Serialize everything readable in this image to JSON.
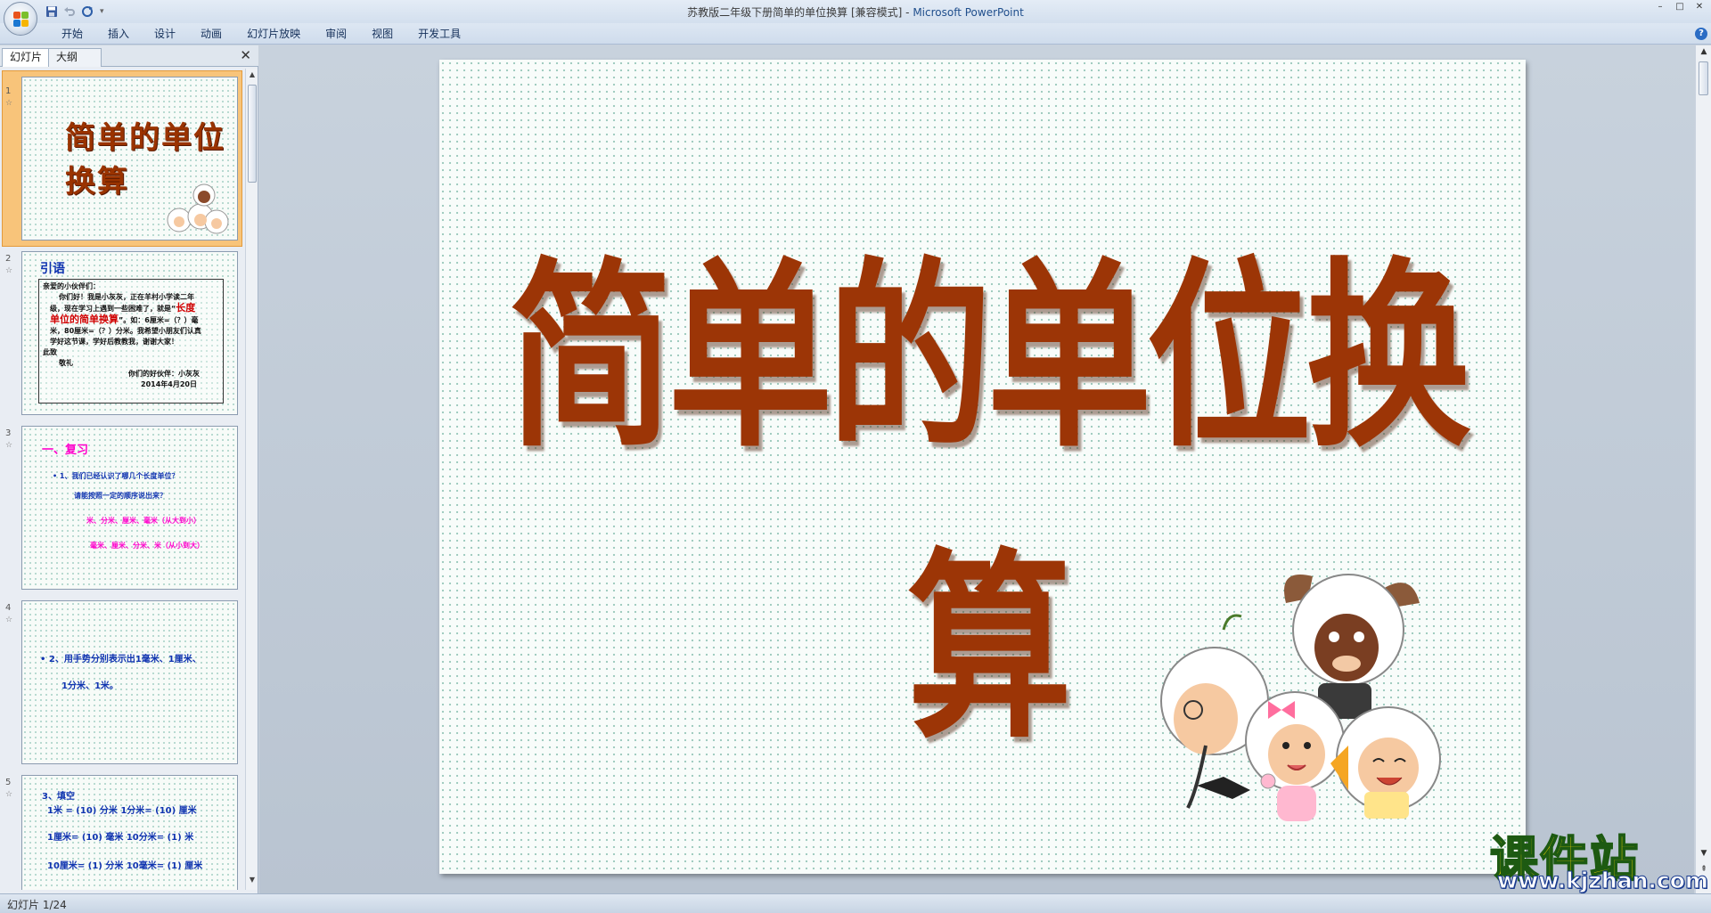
{
  "window": {
    "title": "苏教版二年级下册简单的单位换算 [兼容模式]",
    "app_name": "Microsoft PowerPoint",
    "controls": [
      "–",
      "□",
      "✕"
    ]
  },
  "quick_access": {
    "icons": [
      "save-icon",
      "undo-icon",
      "redo-icon",
      "customize-icon"
    ]
  },
  "ribbon": {
    "tabs": [
      "开始",
      "插入",
      "设计",
      "动画",
      "幻灯片放映",
      "审阅",
      "视图",
      "开发工具"
    ],
    "help": "?"
  },
  "panel": {
    "tabs": [
      "幻灯片",
      "大纲"
    ],
    "close": "✕"
  },
  "thumbnails": {
    "numbers": [
      "1",
      "2",
      "3",
      "4",
      "5"
    ],
    "s1_title": "简单的单位换算",
    "s2_head": "引语",
    "s2_lines": [
      "亲爱的小伙伴们：",
      "你们好！我是小灰灰，正在羊村小学读二年",
      "级，现在学习上遇到一些困难了，就是“",
      "长度",
      "单位的简单换算",
      "”。如：6厘米=（？）毫",
      "米，80厘米=（？）分米。我希望小朋友们认真",
      "学好这节课，学好后教教我，谢谢大家！",
      "此致",
      "敬礼",
      "你们的好伙伴：小灰灰",
      "2014年4月20日"
    ],
    "s3_head": "一、复习",
    "s3_lines": [
      "• 1、我们已经认识了哪几个长度单位？",
      "请能按照一定的顺序说出来？",
      "米、分米、厘米、毫米（从大到小）",
      "毫米、厘米、分米、米（从小到大）"
    ],
    "s4_lines": [
      "• 2、用手势分别表示出1毫米、1厘米、",
      "1分米、1米。"
    ],
    "s5_lines": [
      "3、填空",
      "1米 = (10) 分米     1分米= (10) 厘米",
      "1厘米= (10) 毫米   10分米= (1) 米",
      "10厘米= (1) 分米  10毫米= (1) 厘米"
    ]
  },
  "slide": {
    "title": "简单的单位换算"
  },
  "status": {
    "text": "幻灯片 1/24"
  },
  "watermark": {
    "cn": "课件站",
    "url": "www.kjzhan.com"
  }
}
